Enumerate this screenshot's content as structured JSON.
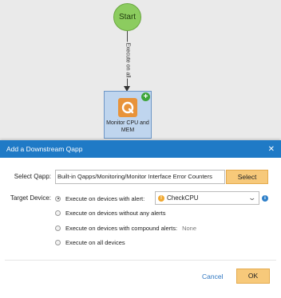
{
  "canvas": {
    "start_label": "Start",
    "edge_label": "Execute on all",
    "qapp_node_label": "Monitor CPU and MEM",
    "add_badge": "+"
  },
  "dialog": {
    "title": "Add a Downstream Qapp",
    "close": "✕",
    "select_qapp_label": "Select Qapp:",
    "qapp_path": "Built-in Qapps/Monitoring/Monitor Interface Error Counters",
    "select_button": "Select",
    "target_device_label": "Target Device:",
    "options": [
      {
        "label": "Execute on devices with alert:",
        "selected": true
      },
      {
        "label": "Execute on devices without any alerts",
        "selected": false
      },
      {
        "label": "Execute on devices with compound alerts:",
        "selected": false,
        "extra": "None"
      },
      {
        "label": "Execute on all devices",
        "selected": false
      }
    ],
    "alert_value": "CheckCPU",
    "cancel_button": "Cancel",
    "ok_button": "OK"
  },
  "colors": {
    "header_blue": "#1f7ac6",
    "button_amber": "#f7c97a",
    "start_green": "#8ccc5f",
    "node_blue": "#bfd5ee",
    "qapp_orange": "#e8933a"
  },
  "icons": [
    "start-node-circle",
    "qapp-logo-icon",
    "add-plus-icon",
    "close-icon",
    "warning-icon",
    "chevron-down-icon",
    "info-icon"
  ]
}
